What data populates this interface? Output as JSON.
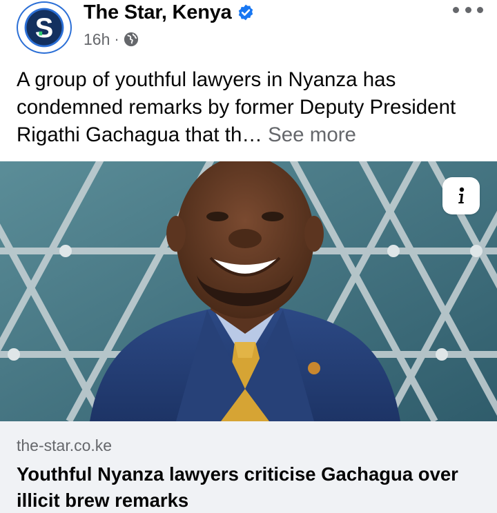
{
  "post": {
    "page_name": "The Star, Kenya",
    "verified_icon": "verified-badge-icon",
    "timestamp": "16h",
    "separator": "·",
    "audience_icon": "globe-icon",
    "more_icon": "more-options-icon",
    "text": "A group of youthful lawyers in Nyanza has condemned remarks by former Deputy President Rigathi Gachagua that th… ",
    "see_more": "See more"
  },
  "avatar": {
    "letter": "S",
    "color_ring": "#2b6fd6",
    "color_fill": "#13305f"
  },
  "photo": {
    "info_icon": "info-icon"
  },
  "link_preview": {
    "domain": "the-star.co.ke",
    "title": "Youthful Nyanza lawyers criticise Gachagua over illicit brew remarks"
  },
  "colors": {
    "accent": "#1877f2",
    "secondary_text": "#65676b",
    "preview_bg": "#f0f2f5"
  }
}
